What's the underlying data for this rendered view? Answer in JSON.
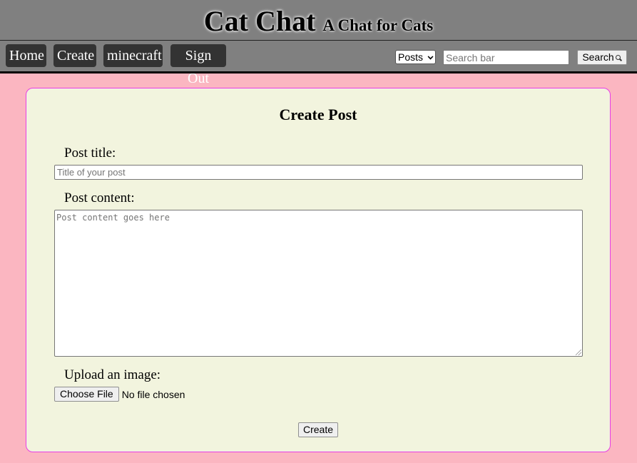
{
  "header": {
    "title": "Cat Chat",
    "subtitle": "A Chat for Cats"
  },
  "nav": {
    "home": "Home",
    "create": "Create",
    "minecraft": "minecraft",
    "sign_out": "Sign Out"
  },
  "search": {
    "type_selected": "Posts",
    "placeholder": "Search bar",
    "button_label": "Search",
    "button_icon": "magnifier-icon"
  },
  "form": {
    "heading": "Create Post",
    "title_label": "Post title:",
    "title_placeholder": "Title of your post",
    "content_label": "Post content:",
    "content_placeholder": "Post content goes here",
    "image_label": "Upload an image:",
    "file_button": "Choose File",
    "file_status": "No file chosen",
    "submit_label": "Create"
  },
  "colors": {
    "page_background": "#fbb6c1",
    "header_background": "#808080",
    "card_background": "#f2f4de",
    "card_border": "#e83ee8",
    "nav_button": "#333333"
  }
}
